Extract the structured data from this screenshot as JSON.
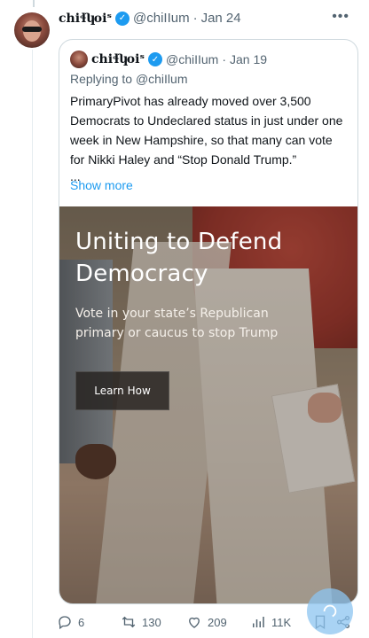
{
  "tweet": {
    "display_name": "chiɬʮoiˢ",
    "handle": "@chiIIum",
    "separator": "·",
    "date": "Jan 24",
    "more_icon": "more-horizontal-icon"
  },
  "quote": {
    "display_name": "chiɬʮoiˢ",
    "handle": "@chiIIum",
    "separator": "·",
    "date": "Jan 19",
    "replying_prefix": "Replying to",
    "replying_to": "@chiIlum",
    "text": "PrimaryPivot has already moved over 3,500 Democrats to Undeclared status in just under one week in New Hampshire, so that many can vote for Nikki Haley and “Stop Donald Trump.”",
    "ellipsis": "...",
    "show_more": "Show more"
  },
  "ad": {
    "headline": "Uniting to Defend Democracy",
    "subtext": "Vote in your state’s Republican primary or caucus to stop Trump",
    "button_label": "Learn How"
  },
  "actions": {
    "replies": "6",
    "retweets": "130",
    "likes": "209",
    "views": "11K"
  },
  "colors": {
    "accent": "#1d9bf0",
    "muted": "#536471"
  }
}
